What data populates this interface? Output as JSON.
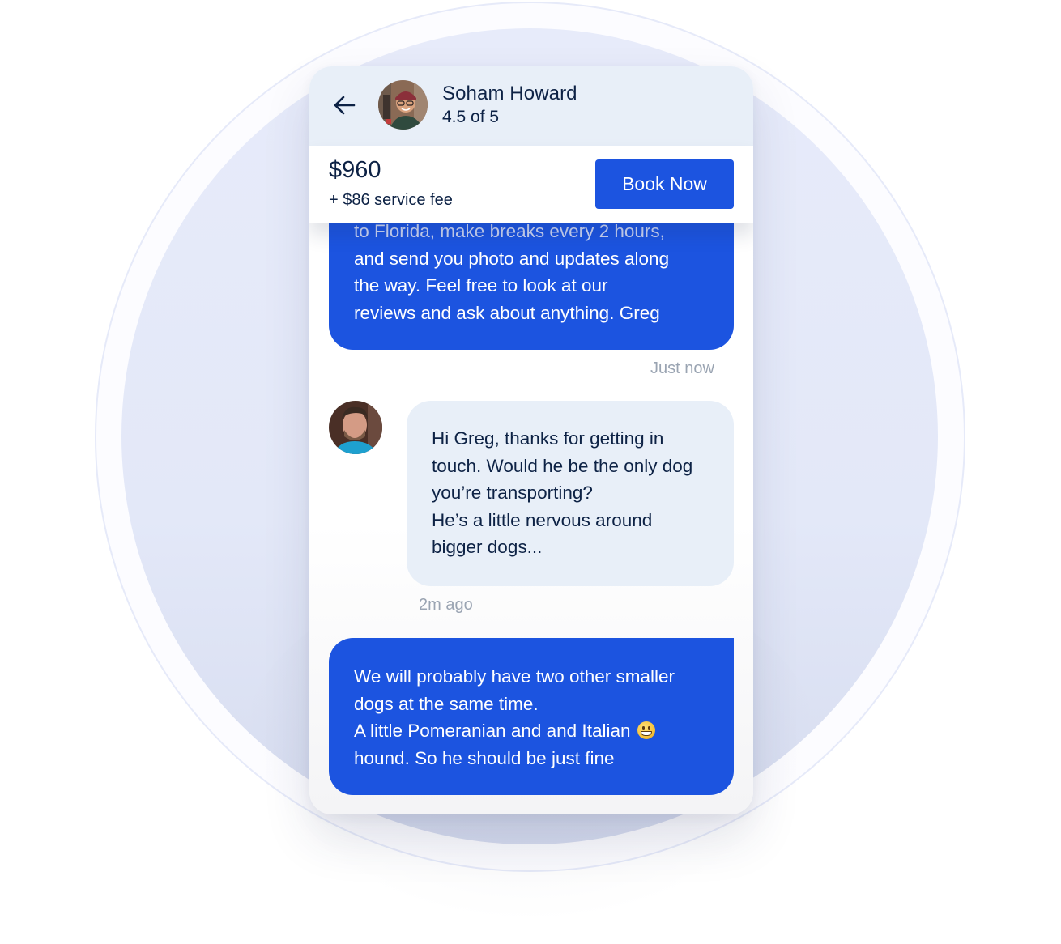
{
  "header": {
    "back_icon": "arrow-left-icon",
    "host_avatar": "avatar-photo-soham-howard",
    "name": "Soham Howard",
    "rating": "4.5 of 5"
  },
  "pricebar": {
    "price": "$960",
    "fee": "+ $86 service fee",
    "book_label": "Book Now"
  },
  "messages": [
    {
      "direction": "outgoing",
      "lines": [
        "to Florida, make breaks every 2 hours,",
        "and send you photo and updates along",
        "the way. Feel free  to look at our",
        "reviews and ask about anything. Greg"
      ],
      "timestamp": "Just now"
    },
    {
      "direction": "incoming",
      "avatar": "avatar-photo-guest",
      "lines": [
        "Hi Greg, thanks for getting in",
        "touch. Would he be the only dog",
        "you’re transporting?",
        "He’s a little nervous around",
        "bigger dogs..."
      ],
      "timestamp": "2m ago"
    },
    {
      "direction": "outgoing",
      "lines": [
        "We will probably have two other smaller",
        "dogs at the same time.",
        "A little Pomeranian and and Italian",
        "hound. So he should be just fine"
      ],
      "emoji": "grinning-face-emoji"
    }
  ],
  "colors": {
    "accent": "#1c54e0",
    "header_bg": "#e8eff8",
    "text_dark": "#0d2245",
    "timestamp": "#9aa4b2",
    "backdrop_disc": "#e5eaf9"
  }
}
